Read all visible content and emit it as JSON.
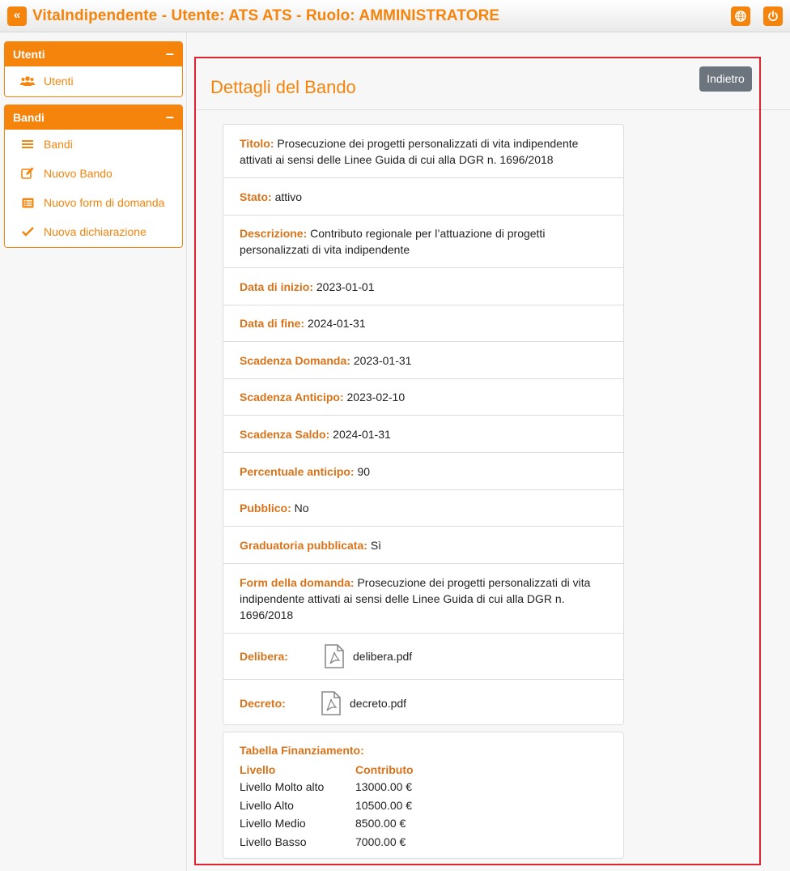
{
  "header": {
    "toggle_glyph": "«",
    "title": "VitaIndipendente - Utente: ATS ATS - Ruolo: AMMINISTRATORE"
  },
  "sidebar": {
    "sections": [
      {
        "title": "Utenti",
        "collapse": "−",
        "items": [
          {
            "label": "Utenti",
            "icon": "users-icon"
          }
        ]
      },
      {
        "title": "Bandi",
        "collapse": "−",
        "items": [
          {
            "label": "Bandi",
            "icon": "list-icon"
          },
          {
            "label": "Nuovo Bando",
            "icon": "edit-icon"
          },
          {
            "label": "Nuovo form di domanda",
            "icon": "list-alt-icon"
          },
          {
            "label": "Nuova dichiarazione",
            "icon": "check-icon"
          }
        ]
      }
    ]
  },
  "main": {
    "title": "Dettagli del Bando",
    "back_label": "Indietro",
    "details": [
      {
        "label": "Titolo:",
        "value": "Prosecuzione dei progetti personalizzati di vita indipendente attivati ai sensi delle Linee Guida di cui alla DGR n. 1696/2018"
      },
      {
        "label": "Stato:",
        "value": "attivo"
      },
      {
        "label": "Descrizione:",
        "value": "Contributo regionale per l’attuazione di progetti personalizzati di vita indipendente"
      },
      {
        "label": "Data di inizio:",
        "value": "2023-01-01"
      },
      {
        "label": "Data di fine:",
        "value": "2024-01-31"
      },
      {
        "label": "Scadenza Domanda:",
        "value": "2023-01-31"
      },
      {
        "label": "Scadenza Anticipo:",
        "value": "2023-02-10"
      },
      {
        "label": "Scadenza Saldo:",
        "value": "2024-01-31"
      },
      {
        "label": "Percentuale anticipo:",
        "value": "90"
      },
      {
        "label": "Pubblico:",
        "value": "No"
      },
      {
        "label": "Graduatoria pubblicata:",
        "value": "Sì"
      },
      {
        "label": "Form della domanda:",
        "value": "Prosecuzione dei progetti personalizzati di vita indipendente attivati ai sensi delle Linee Guida di cui alla DGR n. 1696/2018"
      }
    ],
    "files": [
      {
        "label": "Delibera:",
        "file": "delibera.pdf",
        "icon": "pdf-file-icon"
      },
      {
        "label": "Decreto:",
        "file": "decreto.pdf",
        "icon": "pdf-file-icon"
      }
    ],
    "financing": {
      "title": "Tabella Finanziamento:",
      "headers": [
        "Livello",
        "Contributo"
      ],
      "rows": [
        [
          "Livello Molto alto",
          "13000.00 €"
        ],
        [
          "Livello Alto",
          "10500.00 €"
        ],
        [
          "Livello Medio",
          "8500.00 €"
        ],
        [
          "Livello Basso",
          "7000.00 €"
        ]
      ]
    }
  },
  "colors": {
    "accent": "#f5840c",
    "label": "#d9731a",
    "frame": "#e0242f",
    "button": "#6c757d"
  }
}
